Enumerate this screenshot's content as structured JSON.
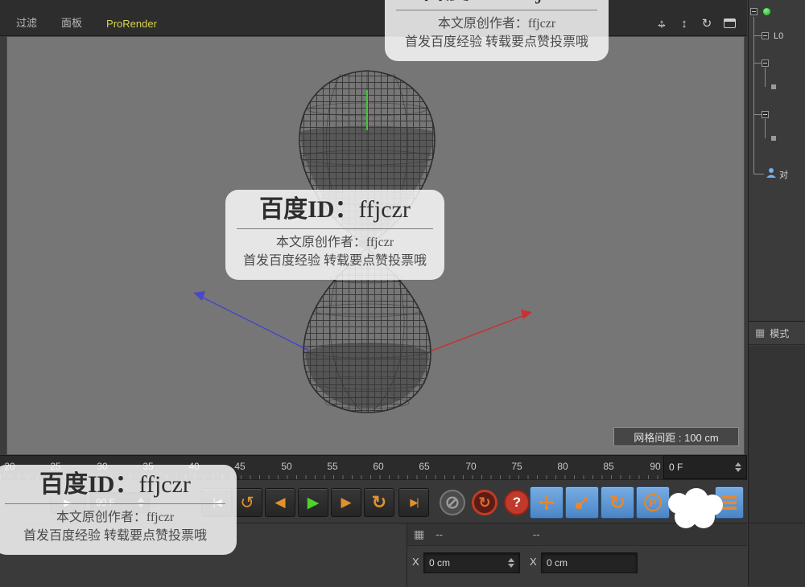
{
  "menu": {
    "filter": "过滤",
    "panel": "面板",
    "prorender": "ProRender"
  },
  "viewport": {
    "grid_info": "网格间距 : 100 cm"
  },
  "watermark": {
    "title_prefix": "百度ID：",
    "title_id": "ffjczr",
    "author": "本文原创作者：ffjczr",
    "footer": "首发百度经验 转载要点赞投票哦"
  },
  "timeline": {
    "ticks": [
      "20",
      "25",
      "30",
      "35",
      "40",
      "45",
      "50",
      "55",
      "60",
      "65",
      "70",
      "75",
      "80",
      "85",
      "90"
    ],
    "current_frame": "0 F",
    "end_frame": "90 F"
  },
  "transport": {
    "p_label": "P"
  },
  "coords": {
    "header_value_1": "--",
    "header_value_2": "--",
    "x1_label": "X",
    "x1_value": "0 cm",
    "x2_label": "X",
    "x2_value": "0 cm"
  },
  "right_panel": {
    "item_l0": "L0",
    "item_obj": "对",
    "mode_label": "模式"
  },
  "icons": {
    "pan_h": "↔",
    "pan_v": "↕",
    "zoom": "↕",
    "rotate_view": "↻",
    "mini_play": "▶",
    "goto_start": "|◀",
    "play_back": "↺",
    "prev_frame": "◀",
    "play": "▶",
    "next_frame": "▶",
    "cycle": "↻",
    "goto_end": "▶|",
    "record_off": "⊘",
    "autokey": "↻",
    "question": "?",
    "rotate_tool": "↻",
    "grid": "▦",
    "pattern": "▦"
  },
  "colors": {
    "accent_yellow": "#d8d44a",
    "tool_blue": "#5a96d4",
    "icon_orange": "#e0922f",
    "play_green": "#4fd32a",
    "axis_red": "#c83232",
    "axis_blue": "#4848c8"
  }
}
